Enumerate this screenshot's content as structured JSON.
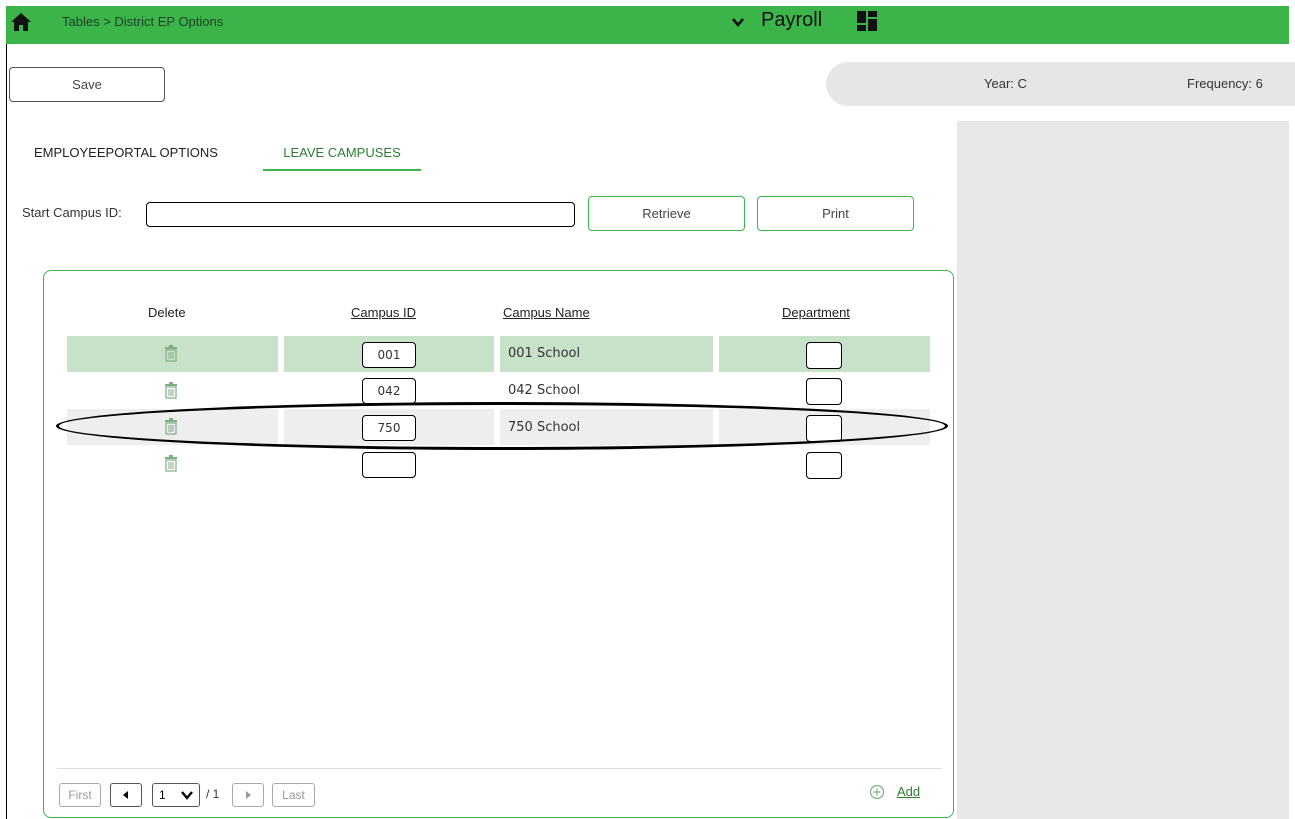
{
  "header": {
    "breadcrumb": "Tables > District EP Options",
    "module": "Payroll",
    "accent_color": "#3bb54a"
  },
  "toolbar": {
    "save_label": "Save",
    "year": "Year: C",
    "frequency": "Frequency: 6"
  },
  "tabs": [
    {
      "label": "EMPLOYEEPORTAL OPTIONS",
      "active": false
    },
    {
      "label": "LEAVE CAMPUSES",
      "active": true
    }
  ],
  "filter": {
    "start_label": "Start Campus ID:",
    "start_value": "",
    "retrieve_label": "Retrieve",
    "print_label": "Print"
  },
  "grid": {
    "columns": [
      "Delete",
      "Campus ID",
      "Campus Name",
      "Department"
    ],
    "rows": [
      {
        "campus_id": "001",
        "campus_name": "001 School",
        "department": ""
      },
      {
        "campus_id": "042",
        "campus_name": "042 School",
        "department": ""
      },
      {
        "campus_id": "750",
        "campus_name": "750 School",
        "department": ""
      },
      {
        "campus_id": "",
        "campus_name": "",
        "department": ""
      }
    ]
  },
  "pager": {
    "first": "First",
    "page": "1",
    "of": "/ 1",
    "last": "Last",
    "add_label": "Add"
  }
}
